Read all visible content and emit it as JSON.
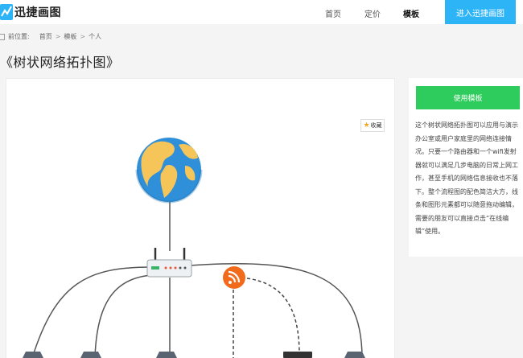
{
  "header": {
    "logo_text": "迅捷画图",
    "nav": [
      "首页",
      "定价",
      "模板"
    ],
    "cta": "进入迅捷画图"
  },
  "breadcrumb": {
    "prefix": "前位置:",
    "items": [
      "首页",
      "模板",
      "个人"
    ],
    "separator": ">"
  },
  "page_title": "《树状网络拓扑图》",
  "preview": {
    "favorite_label": "收藏"
  },
  "sidebar": {
    "use_button": "使用模板",
    "description": "这个树状网络拓扑图可以应用与演示办公室或用户家庭里的网络连接情况。只要一个路由器和一个wifi发射器就可以满足几步电脑的日常上网工作，甚至手机的网络信息接收也不落下。整个流程图的配色简洁大方，线条和图形元素都可以随意拖动编辑，需要的朋友可以直接点击“在线编辑”使用。"
  },
  "colors": {
    "cta_blue": "#2db4f7",
    "use_green": "#2ecc5c",
    "globe_ocean": "#2f8fd8",
    "globe_land": "#f6c55a",
    "rss_orange": "#f26b1d"
  }
}
